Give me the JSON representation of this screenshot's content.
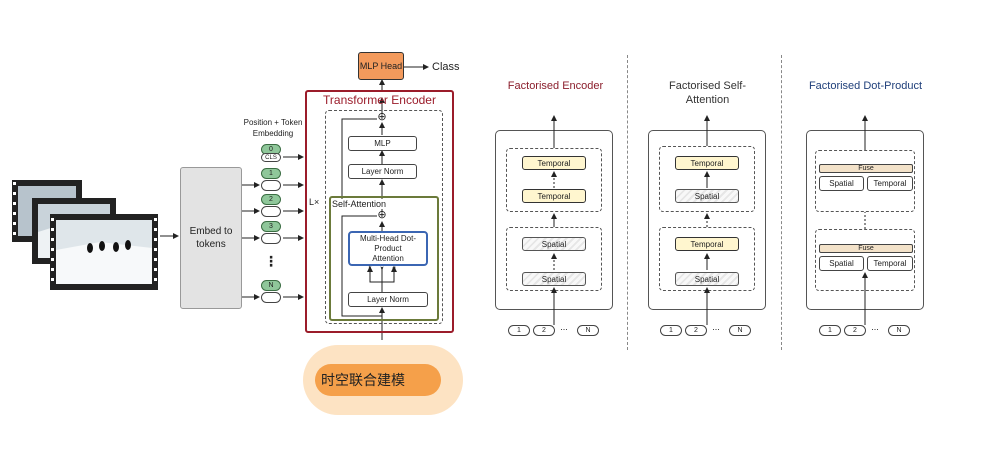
{
  "left": {
    "embed_label": "Embed to tokens",
    "pos_embed_label": "Position + Token Embedding",
    "tokens": [
      "0",
      "CLS",
      "1",
      "2",
      "3",
      "N"
    ],
    "ellipsis": "⋮",
    "mlp_head": "MLP Head",
    "class_label": "Class",
    "encoder_title": "Transformer Encoder",
    "l_times": "L×",
    "self_attention": "Self-Attention",
    "mlp": "MLP",
    "layer_norm_top": "Layer Norm",
    "multi_head": "Multi-Head Dot-Product Attention",
    "qkv": [
      "k",
      "v",
      "q"
    ],
    "layer_norm_bottom": "Layer Norm",
    "plus": "⊕"
  },
  "banner": {
    "text": "时空联合建模",
    "color": "#f5a04a"
  },
  "panels": [
    {
      "title": "Factorised Encoder",
      "title_color": "#8b1e2c",
      "upper": [
        "Temporal",
        "Temporal"
      ],
      "lower": [
        "Spatial",
        "Spatial"
      ]
    },
    {
      "title": "Factorised Self-Attention",
      "title_color": "#333333",
      "upper": [
        "Temporal",
        "Spatial"
      ],
      "lower": [
        "Temporal",
        "Spatial"
      ]
    },
    {
      "title": "Factorised Dot-Product",
      "title_color": "#1f3f7a",
      "fuse": "Fuse",
      "pair": [
        "Spatial",
        "Temporal"
      ]
    }
  ],
  "input_tokens": [
    "1",
    "2",
    "...",
    "N"
  ],
  "colors": {
    "encoder_border": "#9b1c2a",
    "mlp_head": "#f39a5c",
    "self_attn_border": "#6b7a3a",
    "mha_border": "#3b66b3"
  }
}
